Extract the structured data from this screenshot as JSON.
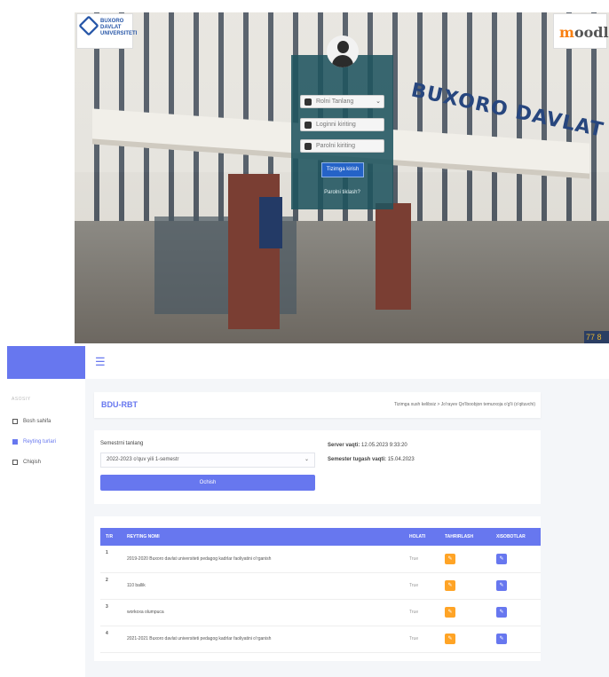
{
  "login": {
    "logo_left_lines": [
      "BUXORO",
      "DAVLAT",
      "UNIVERSITETI"
    ],
    "logo_right_prefix": "m",
    "logo_right_rest": "oodle",
    "role_placeholder": "Rolni Tanlang",
    "login_placeholder": "Loginni kiriting",
    "password_placeholder": "Parolni kiriting",
    "submit_label": "Tizimga kirish",
    "forgot_label": "Parolni tiklash?",
    "building_sign": "BUXORO DAVLAT UNIVERSITETI",
    "corner_badge": "77 8"
  },
  "sidebar": {
    "caption": "ASOSIY",
    "items": [
      {
        "label": "Bosh sahifa",
        "icon": "home-icon"
      },
      {
        "label": "Reyting turlari",
        "icon": "document-icon"
      },
      {
        "label": "Chiqish",
        "icon": "logout-icon"
      }
    ]
  },
  "header": {
    "title": "BDU-RBT",
    "breadcrumb": "Tizimga xush kelibsiz > Jo'rayev Qo'lboobjon temurxoja o'g'li (o'qituvchi)"
  },
  "semester": {
    "label": "Semestrni tanlang",
    "selected": "2022-2023 o'quv yili 1-semestr",
    "button": "Ochish",
    "server_label": "Server vaqti:",
    "server_value": "12.05.2023 9:33:20",
    "end_label": "Semester tugash vaqti:",
    "end_value": "15.04.2023"
  },
  "table": {
    "headers": [
      "T/R",
      "REYTING NOMI",
      "HOLATI",
      "TAHRIRLASH",
      "XISOBOTLAR"
    ],
    "rows": [
      {
        "n": "1",
        "name": "2019-2020 Buxoro davlat universiteti pedagog kadrlar faoliyatini o'rganish",
        "status": "True"
      },
      {
        "n": "2",
        "name": "110 ballik",
        "status": "True"
      },
      {
        "n": "3",
        "name": "workoxa olumpuca",
        "status": "True"
      },
      {
        "n": "4",
        "name": "2021-2021 Buxoro davlat universiteti pedagog kadrlar faoliyatini o'rganish",
        "status": "True"
      }
    ]
  },
  "colors": {
    "accent": "#6777ef",
    "warning": "#ffa426",
    "card_bg": "#1f545f"
  }
}
